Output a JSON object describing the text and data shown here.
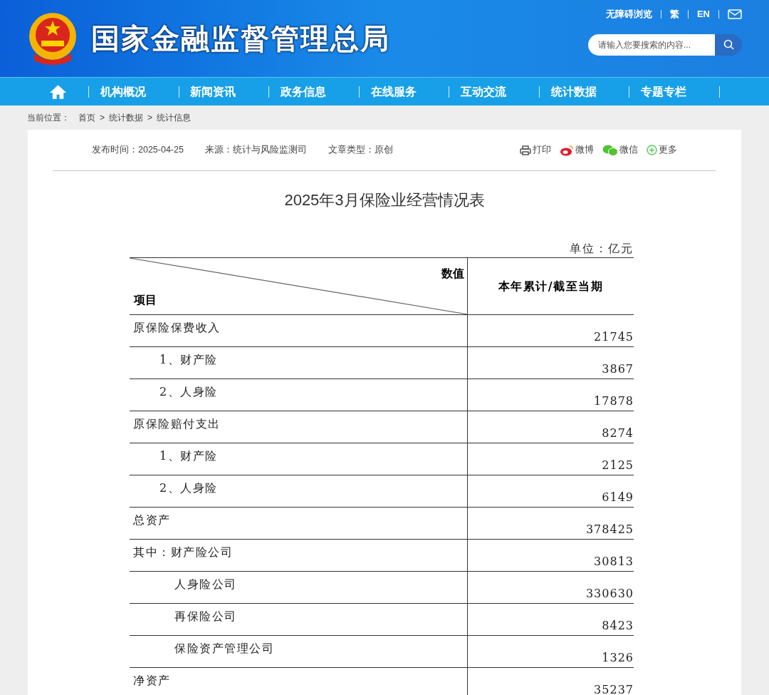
{
  "header": {
    "site_title": "国家金融监督管理总局",
    "links": [
      "无障碍浏览",
      "繁",
      "EN"
    ],
    "search": {
      "placeholder": "请输入您要搜索的内容..."
    }
  },
  "nav": [
    "机构概况",
    "新闻资讯",
    "政务信息",
    "在线服务",
    "互动交流",
    "统计数据",
    "专题专栏"
  ],
  "breadcrumb": {
    "label": "当前位置：",
    "separator": ">",
    "items": [
      "首页",
      "统计数据",
      "统计信息"
    ]
  },
  "meta": [
    "发布时间：2025-04-25",
    "来源：统计与风险监测司",
    "文章类型：原创"
  ],
  "share": [
    {
      "kind": "print",
      "label": "打印"
    },
    {
      "kind": "weibo",
      "label": "微博"
    },
    {
      "kind": "wechat",
      "label": "微信"
    },
    {
      "kind": "more",
      "label": "更多"
    }
  ],
  "article_title": "2025年3月保险业经营情况表",
  "table": {
    "unit": "单位：亿元",
    "corner_top": "数值",
    "corner_bottom": "项目",
    "column": "本年累计/截至当期",
    "rows": [
      {
        "label": "原保险保费收入",
        "value": "21745",
        "children": [
          {
            "label": "1、财产险",
            "value": "3867"
          },
          {
            "label": "2、人身险",
            "value": "17878"
          }
        ]
      },
      {
        "label": "原保险赔付支出",
        "value": "8274",
        "children": [
          {
            "label": "1、财产险",
            "value": "2125"
          },
          {
            "label": "2、人身险",
            "value": "6149"
          }
        ]
      },
      {
        "label": "总资产",
        "value": "378425"
      },
      {
        "prefix": "其中：",
        "label": "财产险公司",
        "value": "30813",
        "children": [
          {
            "label": "人身险公司",
            "value": "330630"
          },
          {
            "label": "再保险公司",
            "value": "8423"
          },
          {
            "label": "保险资产管理公司",
            "value": "1326"
          }
        ]
      },
      {
        "label": "净资产",
        "value": "35237"
      }
    ]
  }
}
